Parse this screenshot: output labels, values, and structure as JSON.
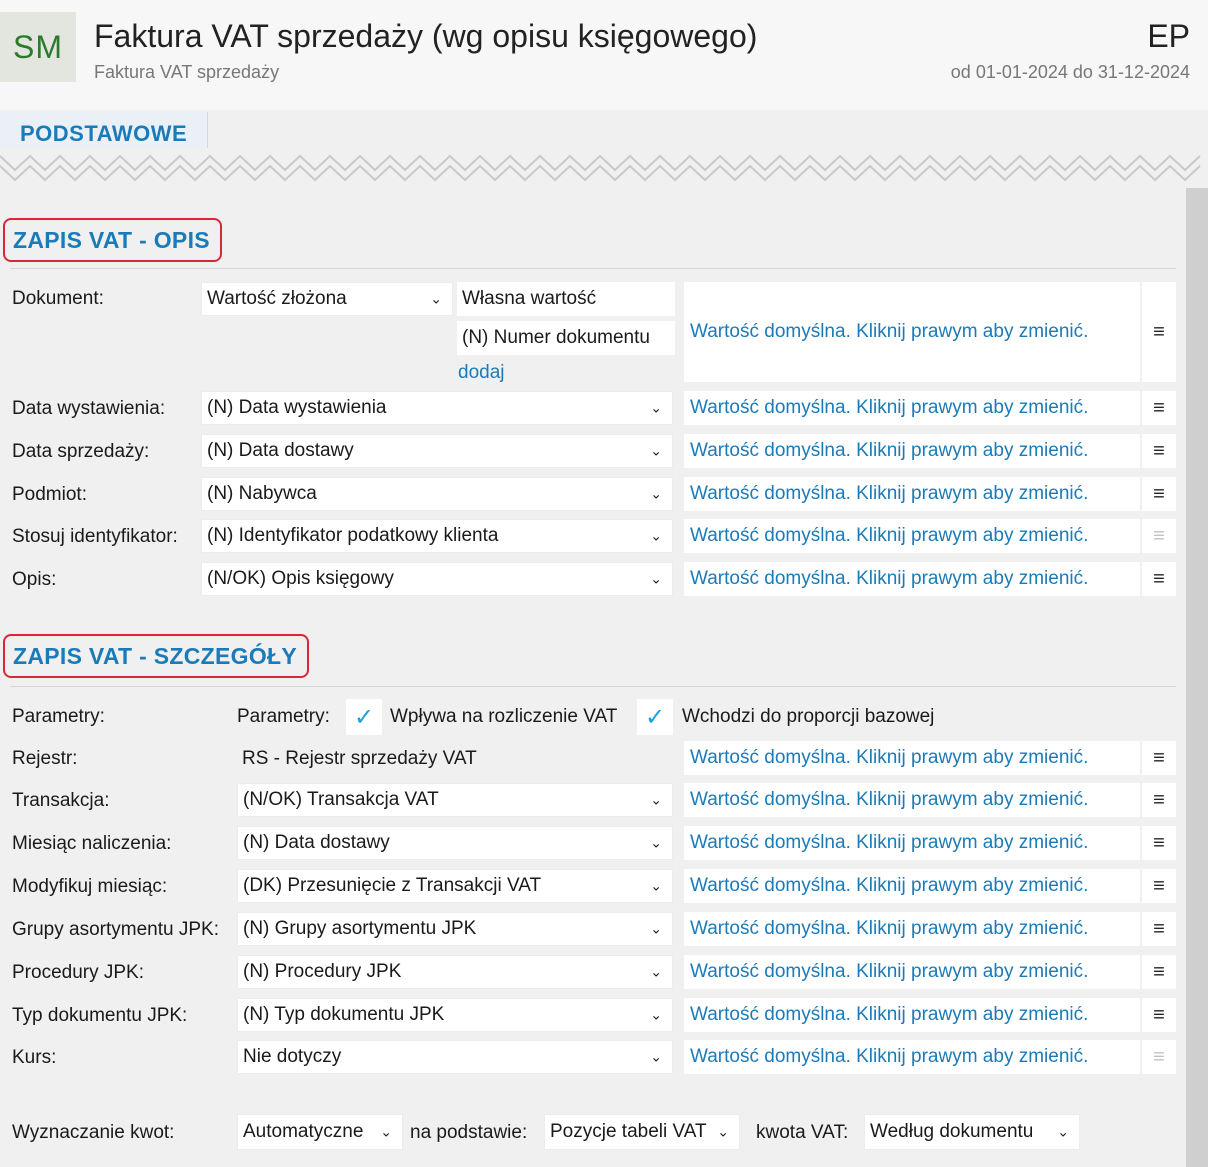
{
  "header": {
    "logo": "SM",
    "title": "Faktura VAT sprzedaży (wg opisu księgowego)",
    "subtitle": "Faktura VAT sprzedaży",
    "code": "EP",
    "period": "od 01-01-2024 do 31-12-2024"
  },
  "tabs": [
    {
      "label": "PODSTAWOWE"
    }
  ],
  "hint_text": "Wartość domyślna. Kliknij prawym aby zmienić.",
  "menu_glyph": "≡",
  "chevron": "⌄",
  "check": "✓",
  "opis": {
    "title": "ZAPIS VAT - OPIS",
    "dokument": {
      "label": "Dokument:",
      "type": "Wartość złożona",
      "part1": "Własna wartość",
      "part2": "(N) Numer dokumentu",
      "add": "dodaj"
    },
    "rows": [
      {
        "label": "Data wystawienia:",
        "value": "(N) Data wystawienia"
      },
      {
        "label": "Data sprzedaży:",
        "value": "(N) Data dostawy"
      },
      {
        "label": "Podmiot:",
        "value": "(N) Nabywca"
      },
      {
        "label": "Stosuj identyfikator:",
        "value": "(N) Identyfikator podatkowy klienta"
      },
      {
        "label": "Opis:",
        "value": "(N/OK) Opis księgowy"
      }
    ]
  },
  "szczegoly": {
    "title": "ZAPIS VAT - SZCZEGÓŁY",
    "parametry": {
      "label": "Parametry:",
      "inner_label": "Parametry:",
      "check1": "Wpływa na rozliczenie VAT",
      "check2": "Wchodzi do proporcji bazowej"
    },
    "rejestr": {
      "label": "Rejestr:",
      "value": "RS - Rejestr sprzedaży VAT"
    },
    "rows": [
      {
        "label": "Transakcja:",
        "value": "(N/OK) Transakcja VAT"
      },
      {
        "label": "Miesiąc naliczenia:",
        "value": "(N) Data dostawy"
      },
      {
        "label": "Modyfikuj miesiąc:",
        "value": "(DK) Przesunięcie z Transakcji VAT"
      },
      {
        "label": "Grupy asortymentu JPK:",
        "value": "(N) Grupy asortymentu JPK"
      },
      {
        "label": "Procedury JPK:",
        "value": "(N) Procedury JPK"
      },
      {
        "label": "Typ dokumentu JPK:",
        "value": "(N) Typ dokumentu JPK"
      },
      {
        "label": "Kurs:",
        "value": "Nie dotyczy"
      }
    ],
    "kwoty": {
      "label": "Wyznaczanie kwot:",
      "mode": "Automatyczne",
      "basis_label": "na podstawie:",
      "basis": "Pozycje tabeli VAT",
      "vat_label": "kwota VAT:",
      "vat": "Według dokumentu"
    }
  },
  "colors": {
    "accent": "#1a7bb8",
    "highlight": "#d9263b",
    "check": "#1aa3e0"
  }
}
